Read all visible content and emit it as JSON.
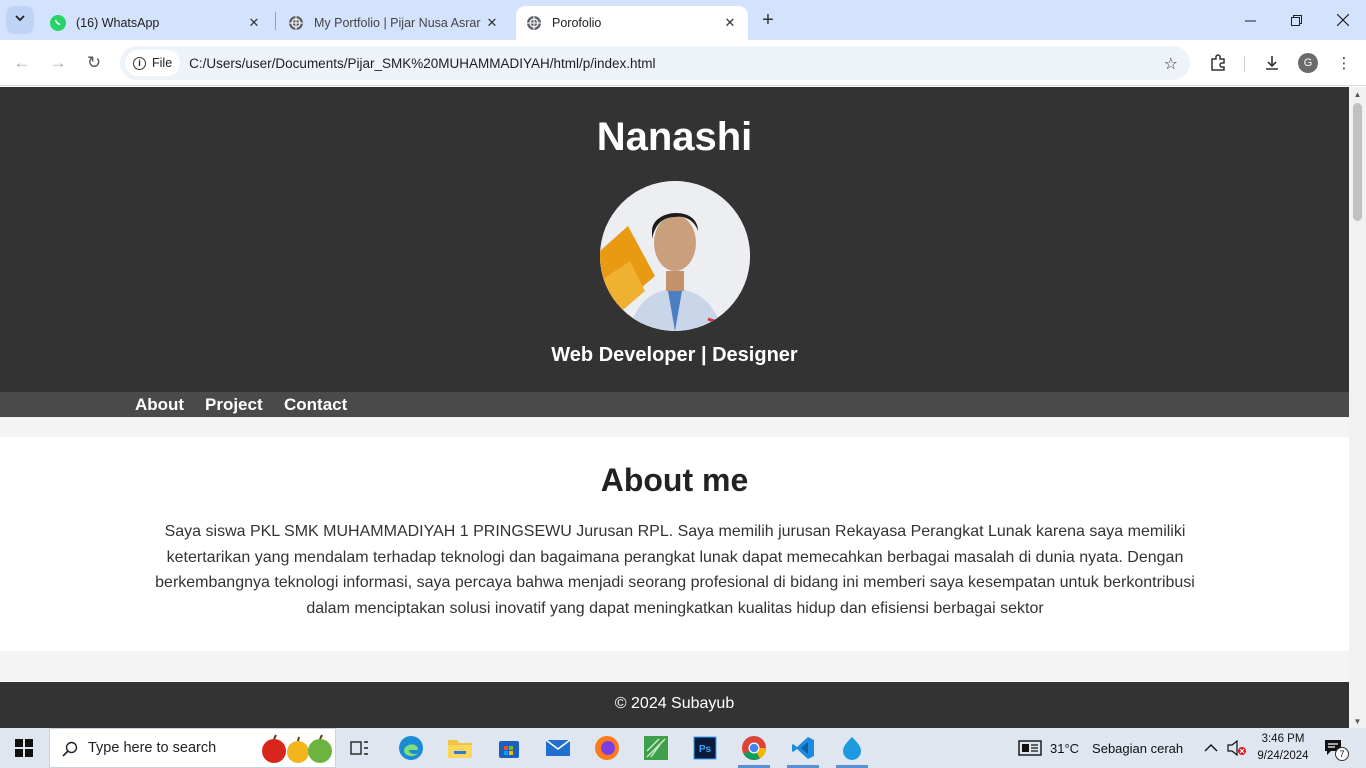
{
  "browser": {
    "tabs": [
      {
        "title": "(16) WhatsApp",
        "icon": "whatsapp-icon",
        "active": false
      },
      {
        "title": "My Portfolio | Pijar Nusa Asrar Tim",
        "icon": "globe-icon",
        "active": false
      },
      {
        "title": "Porofolio",
        "icon": "globe-icon",
        "active": true
      }
    ],
    "address": {
      "scheme_label": "File",
      "url": "C:/Users/user/Documents/Pijar_SMK%20MUHAMMADIYAH/html/p/index.html"
    },
    "profile_initial": "G",
    "colors": {
      "tabstrip": "#d3e3fd",
      "omnibox": "#eef2f9"
    }
  },
  "page": {
    "header": {
      "name": "Nanashi",
      "role": "Web Developer | Designer"
    },
    "nav": [
      "About",
      "Project",
      "Contact"
    ],
    "about": {
      "heading": "About me",
      "text": "Saya siswa PKL SMK MUHAMMADIYAH 1 PRINGSEWU Jurusan RPL. Saya memilih jurusan Rekayasa Perangkat Lunak karena saya memiliki ketertarikan yang mendalam terhadap teknologi dan bagaimana perangkat lunak dapat memecahkan berbagai masalah di dunia nyata. Dengan berkembangnya teknologi informasi, saya percaya bahwa menjadi seorang profesional di bidang ini memberi saya kesempatan untuk berkontribusi dalam menciptakan solusi inovatif yang dapat meningkatkan kualitas hidup dan efisiensi berbagai sektor"
    },
    "footer": "© 2024 Subayub",
    "colors": {
      "header_bg": "#333333",
      "nav_bg": "#4a4a4a",
      "body_bg": "#f4f4f4"
    }
  },
  "taskbar": {
    "search_placeholder": "Type here to search",
    "weather": {
      "temp": "31°C",
      "condition": "Sebagian cerah"
    },
    "clock": {
      "time": "3:46 PM",
      "date": "9/24/2024"
    },
    "notification_count": "7"
  }
}
